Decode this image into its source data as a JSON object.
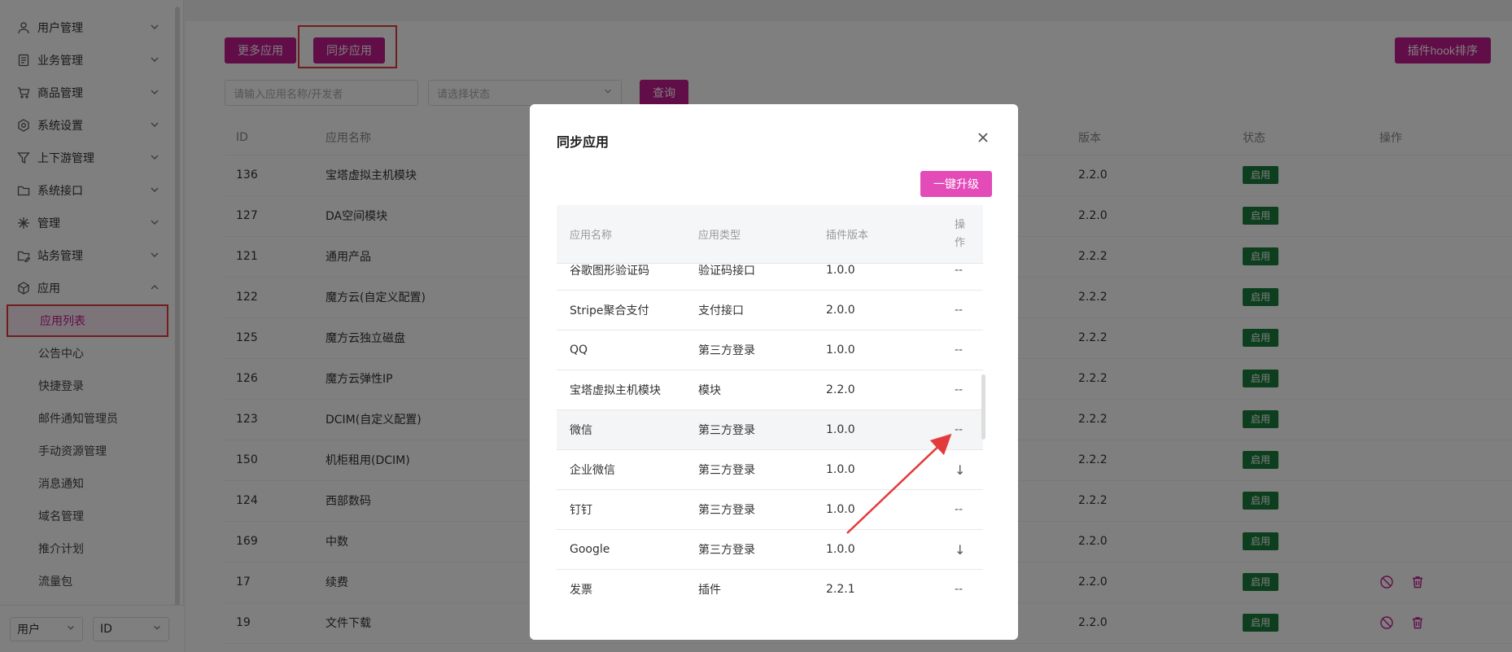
{
  "sidebar": {
    "menu": [
      {
        "label": "用户管理",
        "icon": "user-icon"
      },
      {
        "label": "业务管理",
        "icon": "document-icon"
      },
      {
        "label": "商品管理",
        "icon": "cart-icon"
      },
      {
        "label": "系统设置",
        "icon": "gear-icon"
      },
      {
        "label": "上下游管理",
        "icon": "filter-icon"
      },
      {
        "label": "系统接口",
        "icon": "folder-icon"
      },
      {
        "label": "管理",
        "icon": "asterisk-icon"
      },
      {
        "label": "站务管理",
        "icon": "folder-edit-icon"
      },
      {
        "label": "应用",
        "icon": "cube-icon"
      }
    ],
    "submenu": [
      {
        "label": "应用列表"
      },
      {
        "label": "公告中心"
      },
      {
        "label": "快捷登录"
      },
      {
        "label": "邮件通知管理员"
      },
      {
        "label": "手动资源管理"
      },
      {
        "label": "消息通知"
      },
      {
        "label": "域名管理"
      },
      {
        "label": "推介计划"
      },
      {
        "label": "流量包"
      }
    ],
    "bottom": {
      "select1": "用户",
      "select2": "ID"
    }
  },
  "toolbar": {
    "more_apps": "更多应用",
    "sync_apps": "同步应用",
    "hook_sort": "插件hook排序",
    "search_placeholder": "请输入应用名称/开发者",
    "status_placeholder": "请选择状态",
    "query": "查询"
  },
  "table": {
    "headers": {
      "id": "ID",
      "name": "应用名称",
      "version": "版本",
      "status": "状态",
      "ops": "操作"
    },
    "rows": [
      {
        "id": "136",
        "name": "宝塔虚拟主机模块",
        "version": "2.2.0",
        "status": "启用"
      },
      {
        "id": "127",
        "name": "DA空间模块",
        "version": "2.2.0",
        "status": "启用"
      },
      {
        "id": "121",
        "name": "通用产品",
        "version": "2.2.2",
        "status": "启用"
      },
      {
        "id": "122",
        "name": "魔方云(自定义配置)",
        "version": "2.2.2",
        "status": "启用"
      },
      {
        "id": "125",
        "name": "魔方云独立磁盘",
        "version": "2.2.2",
        "status": "启用"
      },
      {
        "id": "126",
        "name": "魔方云弹性IP",
        "version": "2.2.2",
        "status": "启用"
      },
      {
        "id": "123",
        "name": "DCIM(自定义配置)",
        "version": "2.2.2",
        "status": "启用"
      },
      {
        "id": "150",
        "name": "机柜租用(DCIM)",
        "version": "2.2.2",
        "status": "启用"
      },
      {
        "id": "124",
        "name": "西部数码",
        "version": "2.2.2",
        "status": "启用"
      },
      {
        "id": "169",
        "name": "中数",
        "version": "2.2.0",
        "status": "启用"
      },
      {
        "id": "17",
        "name": "续费",
        "version": "2.2.0",
        "status": "启用"
      },
      {
        "id": "19",
        "name": "文件下载",
        "version": "2.2.0",
        "status": "启用"
      }
    ]
  },
  "modal": {
    "title": "同步应用",
    "upgrade_all": "一键升级",
    "headers": {
      "name": "应用名称",
      "type": "应用类型",
      "version": "插件版本",
      "ops_line1": "操",
      "ops_line2": "作"
    },
    "rows": [
      {
        "name": "谷歌图形验证码",
        "type": "验证码接口",
        "version": "1.0.0",
        "op": "--"
      },
      {
        "name": "Stripe聚合支付",
        "type": "支付接口",
        "version": "2.0.0",
        "op": "--"
      },
      {
        "name": "QQ",
        "type": "第三方登录",
        "version": "1.0.0",
        "op": "--"
      },
      {
        "name": "宝塔虚拟主机模块",
        "type": "模块",
        "version": "2.2.0",
        "op": "--"
      },
      {
        "name": "微信",
        "type": "第三方登录",
        "version": "1.0.0",
        "op": "--"
      },
      {
        "name": "企业微信",
        "type": "第三方登录",
        "version": "1.0.0",
        "op": "↓"
      },
      {
        "name": "钉钉",
        "type": "第三方登录",
        "version": "1.0.0",
        "op": "--"
      },
      {
        "name": "Google",
        "type": "第三方登录",
        "version": "1.0.0",
        "op": "↓"
      },
      {
        "name": "发票",
        "type": "插件",
        "version": "2.2.1",
        "op": "--"
      }
    ]
  },
  "colors": {
    "accent": "#c21b8e",
    "upgrade": "#e34bb8",
    "status_green": "#1a7d3d",
    "annotation_red": "#e33b3b"
  }
}
